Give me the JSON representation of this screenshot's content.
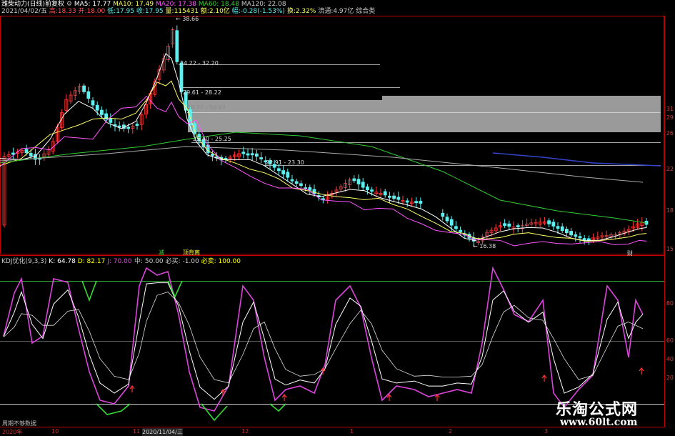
{
  "header": {
    "stock_name": "潍柴动力(日线)",
    "adjust_mode": "前复权",
    "ma5": "MA5: 17.77",
    "ma10": "MA10: 17.49",
    "ma20": "MA20: 17.38",
    "ma60": "MA60: 18.48",
    "ma120": "MA120: 22.08"
  },
  "info_line": {
    "date": "2021/04/02/五",
    "high": "高:18.33",
    "open": "开:18.00",
    "low": "低:17.95",
    "close": "收:17.95",
    "volume": "量:115431",
    "amount": "额:2.10亿",
    "change": "幅:-0.28(-1.53%)",
    "turnover": "换:2.32%",
    "float_cap": "流通:4.97亿",
    "sector": "综合类"
  },
  "price_annotations": {
    "peak_label": "38.66",
    "low_label": "16.38",
    "levels": [
      "34.22 - 32.20",
      "29.61 - 28.22",
      "29.77 - 30.67",
      "25.40 - 25.25",
      "22.91 - 23.30"
    ]
  },
  "price_axis_labels": [
    "31",
    "29",
    "26",
    "22",
    "18",
    "15"
  ],
  "indicator": {
    "name": "KDJ优化(9,3,3)",
    "k": "K: 64.78",
    "d": "D: 82.17",
    "j": "J: 70.00",
    "mid": "中: 50.00",
    "must_buy": "必买: -1.00",
    "must_sell": "必卖: 100.00"
  },
  "indicator_axis_labels": [
    "80",
    "60",
    "40",
    "20"
  ],
  "signal_labels": {
    "buy": "减",
    "sell": "顶背离",
    "dividend": "财"
  },
  "x_axis_labels": [
    "2020年",
    "10",
    "11",
    "2020/11/04/三",
    "12",
    "1",
    "2",
    "3"
  ],
  "footer_note": "周期不够数据",
  "watermark": {
    "title": "乐淘公式网",
    "url": "www.60lt.com"
  },
  "colors": {
    "up_candle": "#ff3b3b",
    "down_candle": "#5cf0f0",
    "ma5": "#ffffff",
    "ma10": "#ffff66",
    "ma20": "#ff55ff",
    "ma60": "#33cc33",
    "ma120": "#aaaaaa",
    "k_line": "#ffffff",
    "d_line": "#ffff00",
    "j_line": "#dd44dd",
    "divider": "#c00000"
  }
}
